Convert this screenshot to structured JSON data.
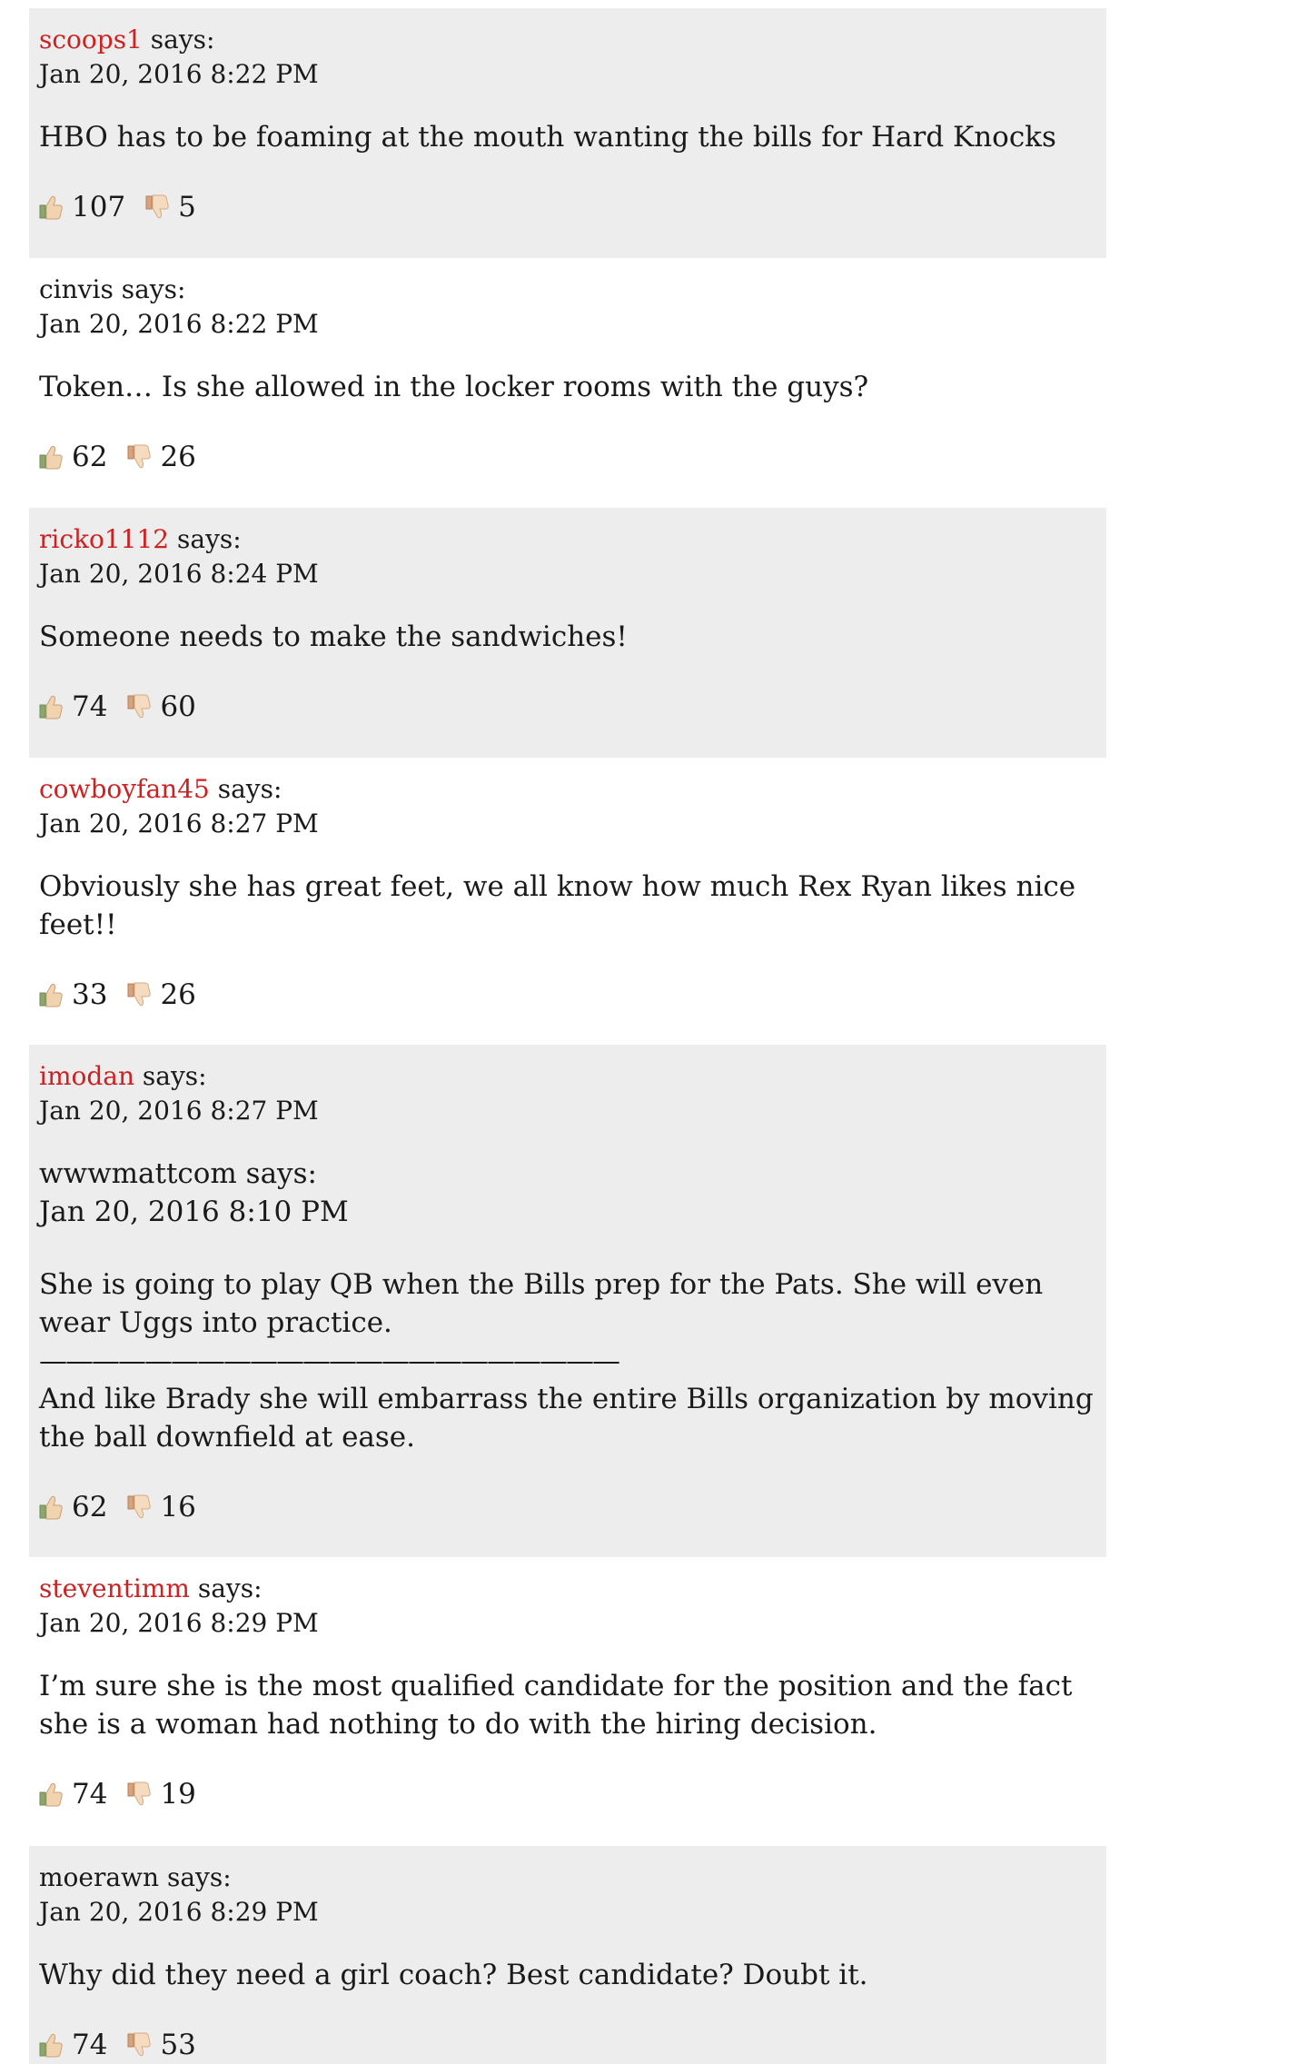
{
  "says_label": "says:",
  "colors": {
    "author_link": "#cc2222",
    "shaded_bg": "#ededed",
    "thumb_up": "#8aa86a",
    "thumb_down": "#d8a27a"
  },
  "comments": [
    {
      "author": "scoops1",
      "linked": true,
      "timestamp": "Jan 20, 2016 8:22 PM",
      "body": [
        "HBO has to be foaming at the mouth wanting the bills for Hard Knocks"
      ],
      "likes": "107",
      "dislikes": "5"
    },
    {
      "author": "cinvis",
      "linked": false,
      "timestamp": "Jan 20, 2016 8:22 PM",
      "body": [
        "Token… Is she allowed in the locker rooms with the guys?"
      ],
      "likes": "62",
      "dislikes": "26"
    },
    {
      "author": "ricko1112",
      "linked": true,
      "timestamp": "Jan 20, 2016 8:24 PM",
      "body": [
        "Someone needs to make the sandwiches!"
      ],
      "likes": "74",
      "dislikes": "60"
    },
    {
      "author": "cowboyfan45",
      "linked": true,
      "timestamp": "Jan 20, 2016 8:27 PM",
      "body": [
        "Obviously she has great feet, we all know how much Rex Ryan likes nice feet!!"
      ],
      "likes": "33",
      "dislikes": "26"
    },
    {
      "author": "imodan",
      "linked": true,
      "timestamp": "Jan 20, 2016 8:27 PM",
      "quote": {
        "author_line": "wwwmattcom says:",
        "timestamp": "Jan 20, 2016 8:10 PM",
        "text": "She is going to play QB when the Bills prep for the Pats. She will even wear Uggs into practice."
      },
      "rule": "——————————————————————",
      "body": [
        "And like Brady she will embarrass the entire Bills organization by moving the ball downfield at ease."
      ],
      "likes": "62",
      "dislikes": "16"
    },
    {
      "author": "steventimm",
      "linked": true,
      "timestamp": "Jan 20, 2016 8:29 PM",
      "body": [
        "I’m sure she is the most qualified candidate for the position and the fact she is a woman had nothing to do with the hiring decision."
      ],
      "likes": "74",
      "dislikes": "19"
    },
    {
      "author": "moerawn",
      "linked": false,
      "timestamp": "Jan 20, 2016 8:29 PM",
      "body": [
        "Why did they need a girl coach? Best candidate? Doubt it."
      ],
      "likes": "74",
      "dislikes": "53"
    }
  ]
}
